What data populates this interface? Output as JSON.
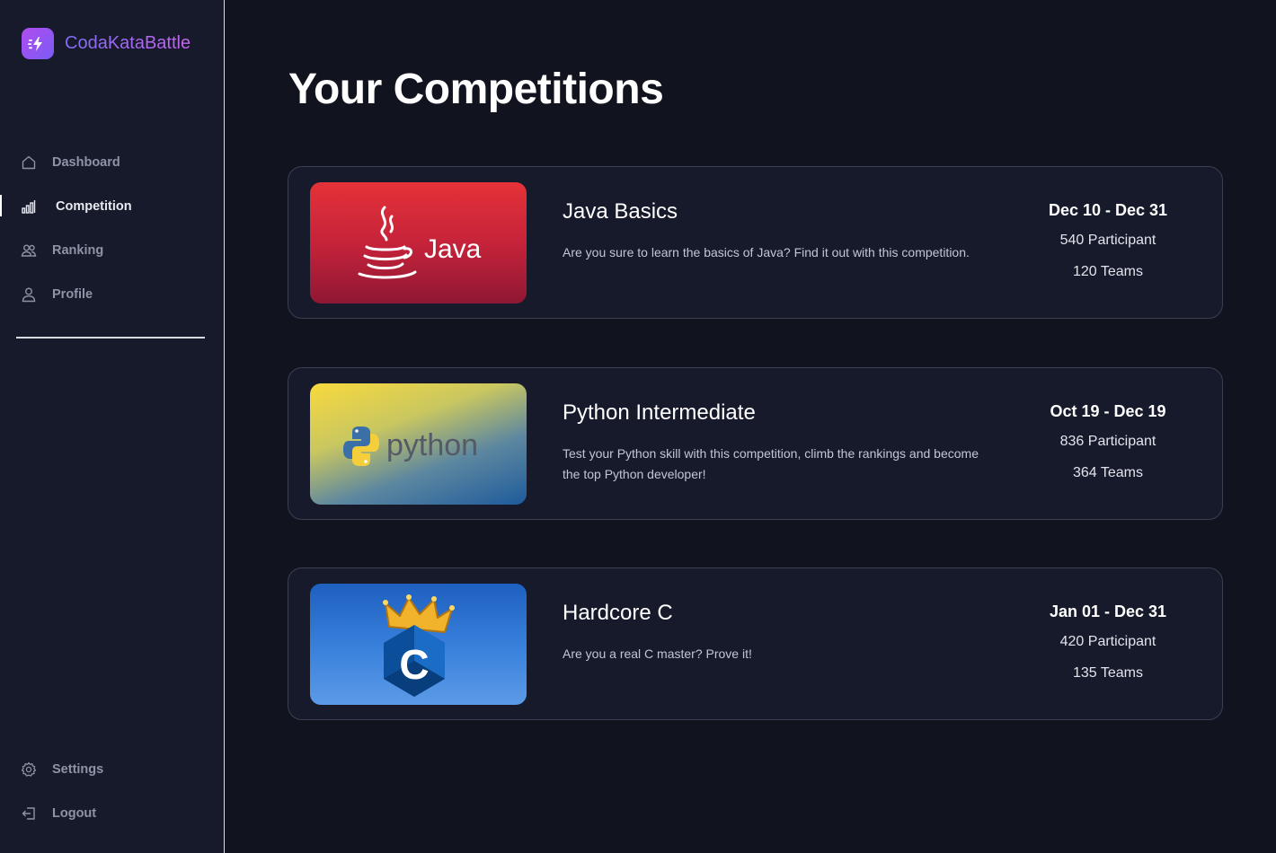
{
  "brand": {
    "name": "CodaKataBattle",
    "accent": "#8b68f6"
  },
  "nav": {
    "items": [
      {
        "label": "Dashboard",
        "icon": "home-icon",
        "active": false
      },
      {
        "label": "Competition",
        "icon": "bar-chart-icon",
        "active": true
      },
      {
        "label": "Ranking",
        "icon": "users-icon",
        "active": false
      },
      {
        "label": "Profile",
        "icon": "user-icon",
        "active": false
      }
    ],
    "bottom": [
      {
        "label": "Settings",
        "icon": "gear-icon"
      },
      {
        "label": "Logout",
        "icon": "logout-icon"
      }
    ]
  },
  "page": {
    "title": "Your Competitions"
  },
  "competitions": [
    {
      "title": "Java Basics",
      "description": "Are you sure to learn the basics of Java? Find it out with this competition.",
      "dates": "Dec 10 - Dec 31",
      "participants": "540 Participant",
      "teams": "120 Teams",
      "logo_text": "Java",
      "logo": "java-logo"
    },
    {
      "title": "Python Intermediate",
      "description": "Test your Python skill with this competition, climb the rankings and become the top Python developer!",
      "dates": "Oct 19 - Dec 19",
      "participants": "836 Participant",
      "teams": "364 Teams",
      "logo_text": "python",
      "logo": "python-logo"
    },
    {
      "title": "Hardcore C",
      "description": "Are you a real C master? Prove it!",
      "dates": "Jan 01 - Dec 31",
      "participants": "420 Participant",
      "teams": "135 Teams",
      "logo_text": "C",
      "logo": "c-crown-logo"
    }
  ]
}
